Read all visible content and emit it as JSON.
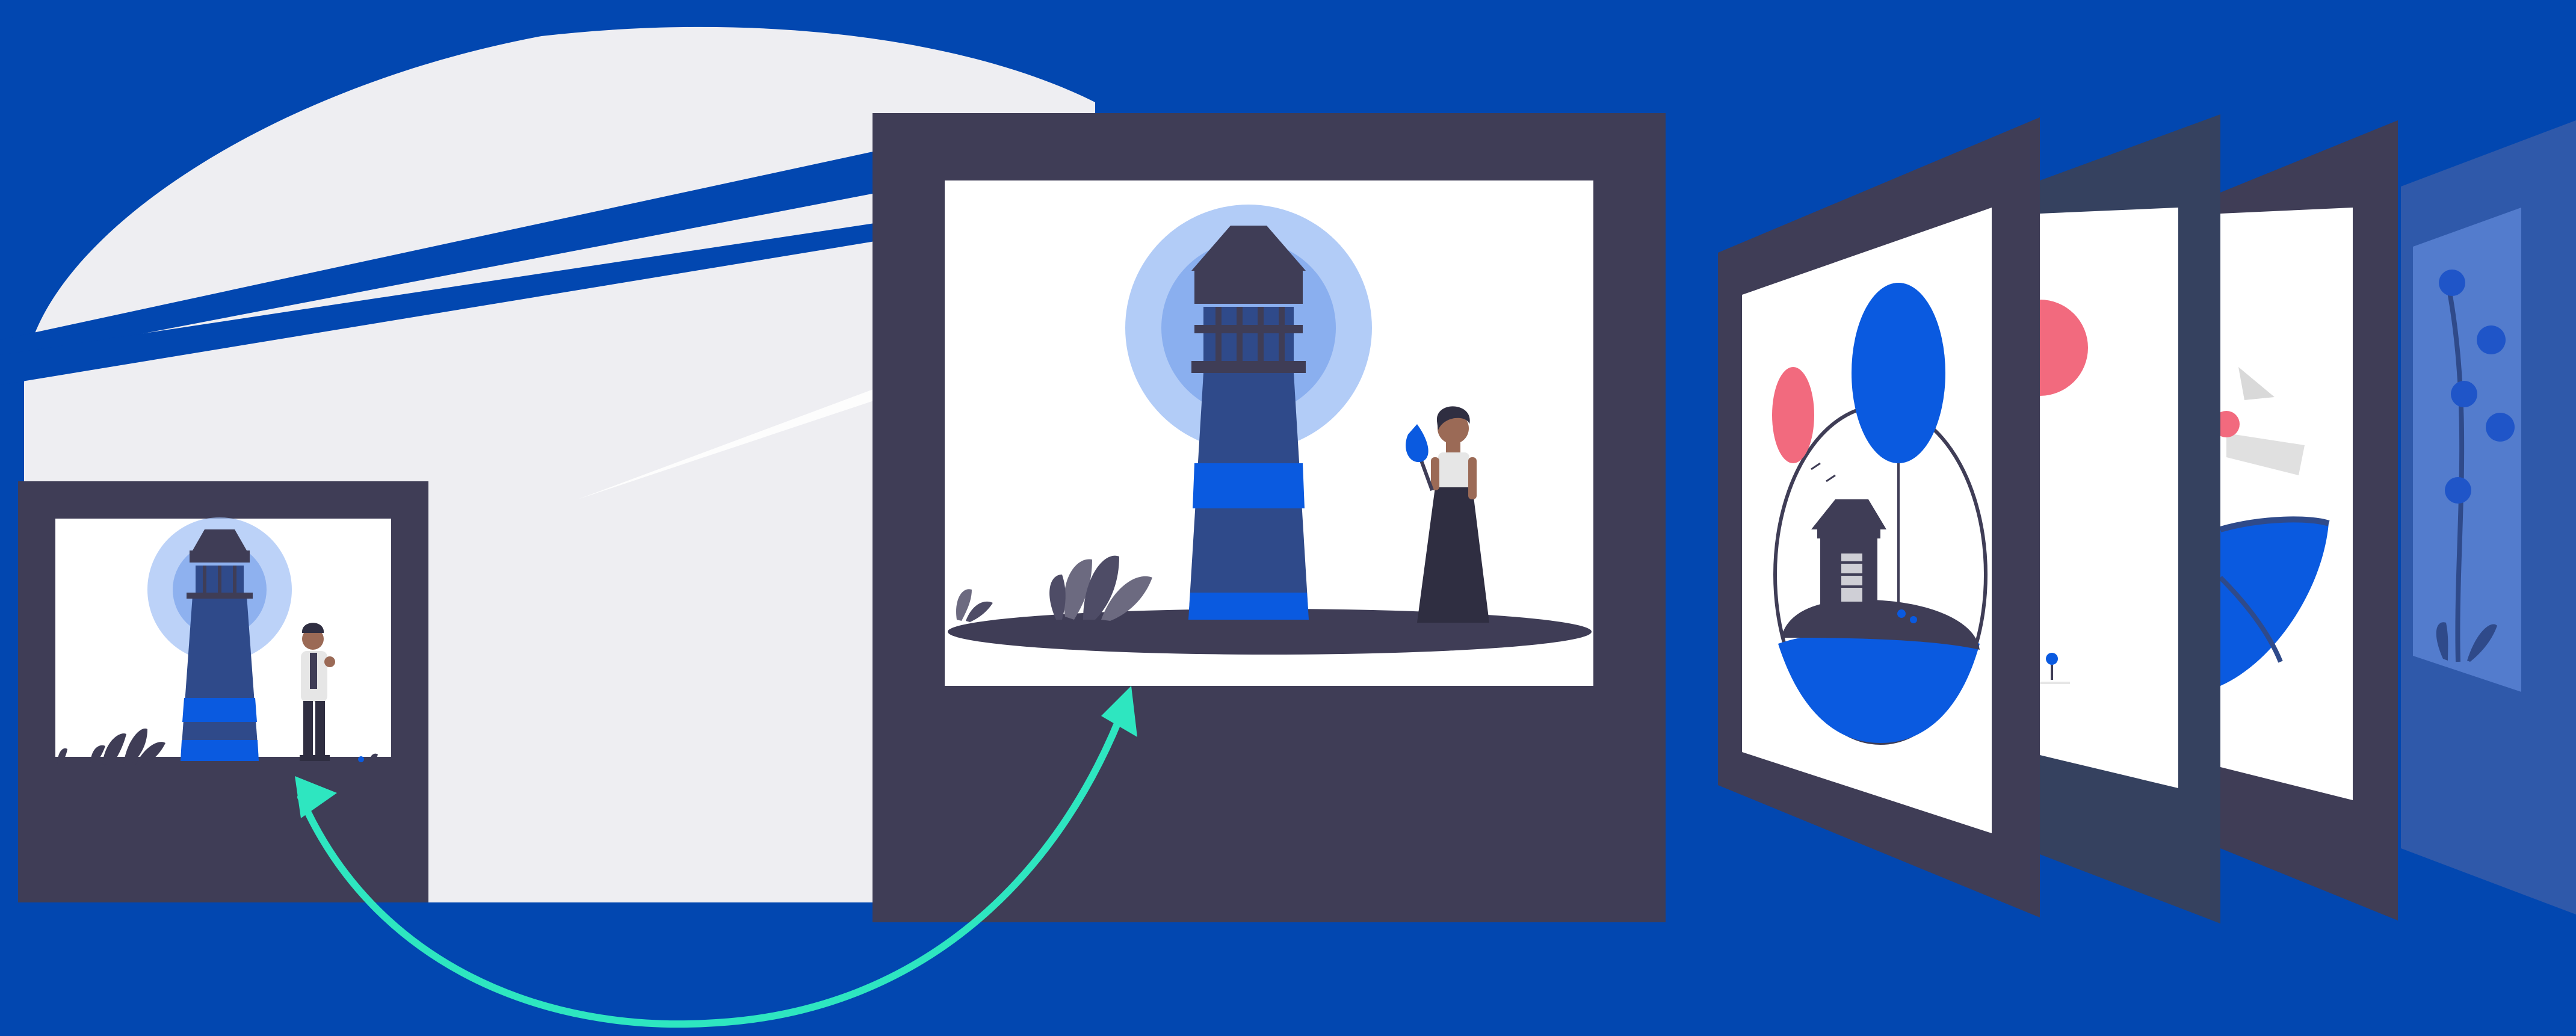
{
  "colors": {
    "background": "#0247B0",
    "backdrop_light": "#EEEEF2",
    "frame_dark": "#3F3D56",
    "card_white": "#FFFFFF",
    "accent_blue": "#0A5AE0",
    "light_blue_glow": "#9FBFF5",
    "mid_blue_glow": "#6F9BEA",
    "tower_dark": "#2F4A8A",
    "pink": "#F26A7E",
    "arrow_teal": "#2EE6C0"
  },
  "icons": {
    "small_card": "lighthouse-illustration-with-man",
    "large_card": "lighthouse-illustration-with-woman",
    "stack_card_1": "hut-on-island-with-balloons",
    "stack_card_2": "partial-illustration-pink-circle",
    "stack_card_3": "partial-illustration-boat",
    "stack_card_4": "plant-silhouette",
    "connector": "double-headed-curved-arrow-icon"
  }
}
